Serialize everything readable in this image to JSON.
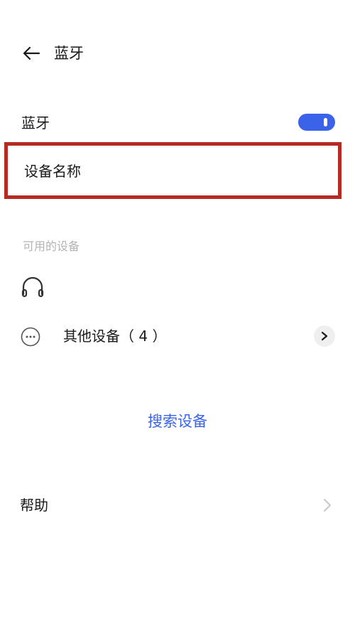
{
  "header": {
    "title": "蓝牙",
    "back_icon": "arrow-left-icon"
  },
  "bluetooth": {
    "label": "蓝牙",
    "enabled": true,
    "accent": "#3a63ea"
  },
  "device_name": {
    "label": "设备名称",
    "highlight_color": "#b52a22"
  },
  "available": {
    "section_title": "可用的设备",
    "devices": [
      {
        "icon": "headphones-icon"
      }
    ],
    "other": {
      "icon": "more-icon",
      "label": "其他设备（ 4 ）",
      "chevron": "chevron-right-icon"
    }
  },
  "search": {
    "label": "搜索设备"
  },
  "help": {
    "label": "帮助",
    "chevron": "chevron-right-icon"
  }
}
